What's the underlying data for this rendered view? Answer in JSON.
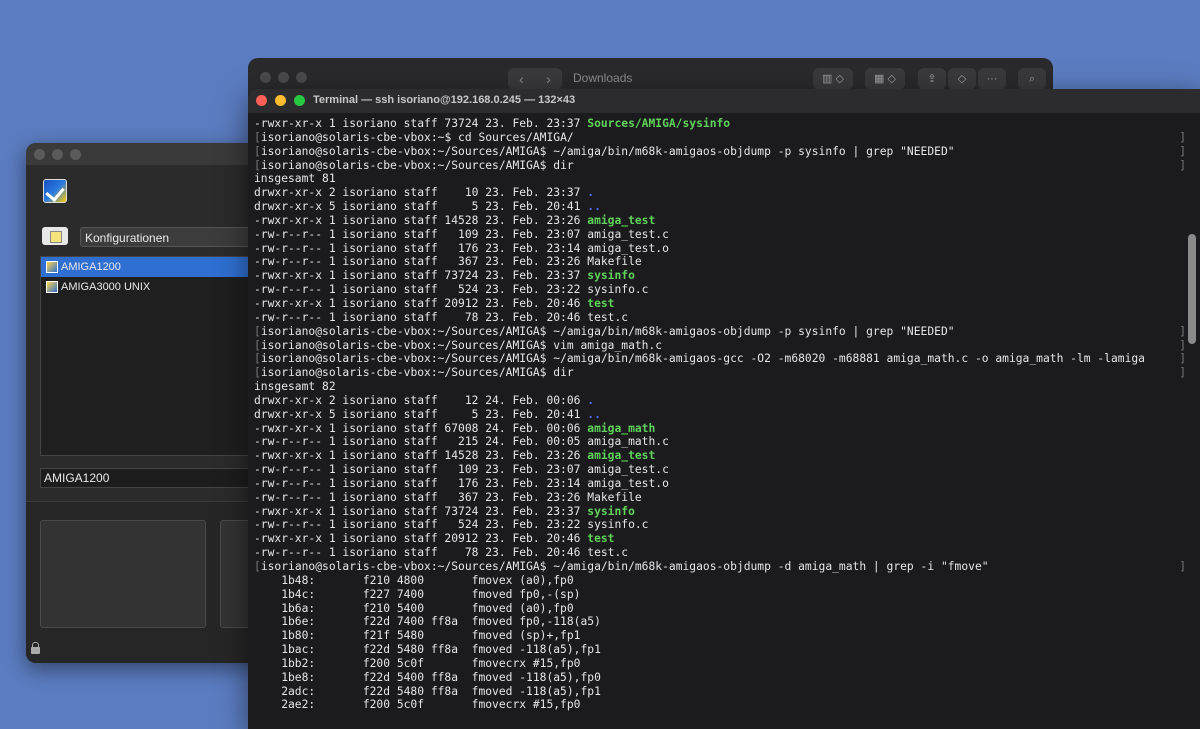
{
  "finder": {
    "title": "Downloads",
    "back_glyph": "‹",
    "forward_glyph": "›",
    "view_glyph": "▥ ◇",
    "group_glyph": "▦ ◇",
    "share_glyph": "⇪",
    "tag_glyph": "◇",
    "more_glyph": "···",
    "search_glyph": "⌕"
  },
  "app": {
    "new_config_icon": "document-icon",
    "config_dropdown_label": "Konfigurationen",
    "configs": [
      {
        "label": "AMIGA1200",
        "selected": true
      },
      {
        "label": "AMIGA3000 UNIX",
        "selected": false
      }
    ],
    "config_name_value": "AMIGA1200"
  },
  "terminal": {
    "title": "Terminal — ssh isoriano@192.168.0.245 — 132×43",
    "lines": [
      {
        "segs": [
          {
            "t": "-rwxr-xr-x 1 isoriano staff 73724 23. Feb. 23:37 "
          },
          {
            "t": "Sources/AMIGA/sysinfo",
            "c": "green"
          }
        ],
        "b": false
      },
      {
        "segs": [
          {
            "t": "isoriano@solaris-cbe-vbox:~$ cd Sources/AMIGA/"
          }
        ],
        "b": true
      },
      {
        "segs": [
          {
            "t": "isoriano@solaris-cbe-vbox:~/Sources/AMIGA$ ~/amiga/bin/m68k-amigaos-objdump -p sysinfo | grep \"NEEDED\""
          }
        ],
        "b": true
      },
      {
        "segs": [
          {
            "t": "isoriano@solaris-cbe-vbox:~/Sources/AMIGA$ dir"
          }
        ],
        "b": true
      },
      {
        "segs": [
          {
            "t": "insgesamt 81"
          }
        ],
        "b": false
      },
      {
        "segs": [
          {
            "t": "drwxr-xr-x 2 isoriano staff    10 23. Feb. 23:37 "
          },
          {
            "t": ".",
            "c": "blue"
          }
        ],
        "b": false
      },
      {
        "segs": [
          {
            "t": "drwxr-xr-x 5 isoriano staff     5 23. Feb. 20:41 "
          },
          {
            "t": "..",
            "c": "blue"
          }
        ],
        "b": false
      },
      {
        "segs": [
          {
            "t": "-rwxr-xr-x 1 isoriano staff 14528 23. Feb. 23:26 "
          },
          {
            "t": "amiga_test",
            "c": "green"
          }
        ],
        "b": false
      },
      {
        "segs": [
          {
            "t": "-rw-r--r-- 1 isoriano staff   109 23. Feb. 23:07 amiga_test.c"
          }
        ],
        "b": false
      },
      {
        "segs": [
          {
            "t": "-rw-r--r-- 1 isoriano staff   176 23. Feb. 23:14 amiga_test.o"
          }
        ],
        "b": false
      },
      {
        "segs": [
          {
            "t": "-rw-r--r-- 1 isoriano staff   367 23. Feb. 23:26 Makefile"
          }
        ],
        "b": false
      },
      {
        "segs": [
          {
            "t": "-rwxr-xr-x 1 isoriano staff 73724 23. Feb. 23:37 "
          },
          {
            "t": "sysinfo",
            "c": "green"
          }
        ],
        "b": false
      },
      {
        "segs": [
          {
            "t": "-rw-r--r-- 1 isoriano staff   524 23. Feb. 23:22 sysinfo.c"
          }
        ],
        "b": false
      },
      {
        "segs": [
          {
            "t": "-rwxr-xr-x 1 isoriano staff 20912 23. Feb. 20:46 "
          },
          {
            "t": "test",
            "c": "green"
          }
        ],
        "b": false
      },
      {
        "segs": [
          {
            "t": "-rw-r--r-- 1 isoriano staff    78 23. Feb. 20:46 test.c"
          }
        ],
        "b": false
      },
      {
        "segs": [
          {
            "t": "isoriano@solaris-cbe-vbox:~/Sources/AMIGA$ ~/amiga/bin/m68k-amigaos-objdump -p sysinfo | grep \"NEEDED\""
          }
        ],
        "b": true
      },
      {
        "segs": [
          {
            "t": "isoriano@solaris-cbe-vbox:~/Sources/AMIGA$ vim amiga_math.c"
          }
        ],
        "b": true
      },
      {
        "segs": [
          {
            "t": "isoriano@solaris-cbe-vbox:~/Sources/AMIGA$ ~/amiga/bin/m68k-amigaos-gcc -O2 -m68020 -m68881 amiga_math.c -o amiga_math -lm -lamiga"
          }
        ],
        "b": true
      },
      {
        "segs": [
          {
            "t": "isoriano@solaris-cbe-vbox:~/Sources/AMIGA$ dir"
          }
        ],
        "b": true
      },
      {
        "segs": [
          {
            "t": "insgesamt 82"
          }
        ],
        "b": false
      },
      {
        "segs": [
          {
            "t": "drwxr-xr-x 2 isoriano staff    12 24. Feb. 00:06 "
          },
          {
            "t": ".",
            "c": "blue"
          }
        ],
        "b": false
      },
      {
        "segs": [
          {
            "t": "drwxr-xr-x 5 isoriano staff     5 23. Feb. 20:41 "
          },
          {
            "t": "..",
            "c": "blue"
          }
        ],
        "b": false
      },
      {
        "segs": [
          {
            "t": "-rwxr-xr-x 1 isoriano staff 67008 24. Feb. 00:06 "
          },
          {
            "t": "amiga_math",
            "c": "green"
          }
        ],
        "b": false
      },
      {
        "segs": [
          {
            "t": "-rw-r--r-- 1 isoriano staff   215 24. Feb. 00:05 amiga_math.c"
          }
        ],
        "b": false
      },
      {
        "segs": [
          {
            "t": "-rwxr-xr-x 1 isoriano staff 14528 23. Feb. 23:26 "
          },
          {
            "t": "amiga_test",
            "c": "green"
          }
        ],
        "b": false
      },
      {
        "segs": [
          {
            "t": "-rw-r--r-- 1 isoriano staff   109 23. Feb. 23:07 amiga_test.c"
          }
        ],
        "b": false
      },
      {
        "segs": [
          {
            "t": "-rw-r--r-- 1 isoriano staff   176 23. Feb. 23:14 amiga_test.o"
          }
        ],
        "b": false
      },
      {
        "segs": [
          {
            "t": "-rw-r--r-- 1 isoriano staff   367 23. Feb. 23:26 Makefile"
          }
        ],
        "b": false
      },
      {
        "segs": [
          {
            "t": "-rwxr-xr-x 1 isoriano staff 73724 23. Feb. 23:37 "
          },
          {
            "t": "sysinfo",
            "c": "green"
          }
        ],
        "b": false
      },
      {
        "segs": [
          {
            "t": "-rw-r--r-- 1 isoriano staff   524 23. Feb. 23:22 sysinfo.c"
          }
        ],
        "b": false
      },
      {
        "segs": [
          {
            "t": "-rwxr-xr-x 1 isoriano staff 20912 23. Feb. 20:46 "
          },
          {
            "t": "test",
            "c": "green"
          }
        ],
        "b": false
      },
      {
        "segs": [
          {
            "t": "-rw-r--r-- 1 isoriano staff    78 23. Feb. 20:46 test.c"
          }
        ],
        "b": false
      },
      {
        "segs": [
          {
            "t": "isoriano@solaris-cbe-vbox:~/Sources/AMIGA$ ~/amiga/bin/m68k-amigaos-objdump -d amiga_math | grep -i \"fmove\""
          }
        ],
        "b": true
      },
      {
        "segs": [
          {
            "t": "    1b48:       f210 4800       fmovex (a0),fp0"
          }
        ],
        "b": false
      },
      {
        "segs": [
          {
            "t": "    1b4c:       f227 7400       fmoved fp0,-(sp)"
          }
        ],
        "b": false
      },
      {
        "segs": [
          {
            "t": "    1b6a:       f210 5400       fmoved (a0),fp0"
          }
        ],
        "b": false
      },
      {
        "segs": [
          {
            "t": "    1b6e:       f22d 7400 ff8a  fmoved fp0,-118(a5)"
          }
        ],
        "b": false
      },
      {
        "segs": [
          {
            "t": "    1b80:       f21f 5480       fmoved (sp)+,fp1"
          }
        ],
        "b": false
      },
      {
        "segs": [
          {
            "t": "    1bac:       f22d 5480 ff8a  fmoved -118(a5),fp1"
          }
        ],
        "b": false
      },
      {
        "segs": [
          {
            "t": "    1bb2:       f200 5c0f       fmovecrx #15,fp0"
          }
        ],
        "b": false
      },
      {
        "segs": [
          {
            "t": "    1be8:       f22d 5400 ff8a  fmoved -118(a5),fp0"
          }
        ],
        "b": false
      },
      {
        "segs": [
          {
            "t": "    2adc:       f22d 5480 ff8a  fmoved -118(a5),fp1"
          }
        ],
        "b": false
      },
      {
        "segs": [
          {
            "t": "    2ae2:       f200 5c0f       fmovecrx #15,fp0"
          }
        ],
        "b": false
      }
    ]
  }
}
